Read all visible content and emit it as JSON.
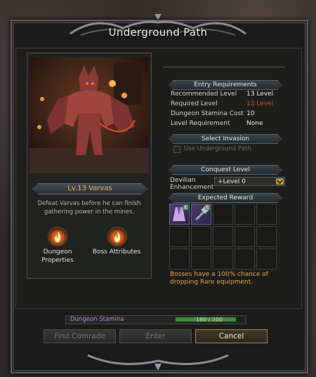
{
  "window": {
    "title": "Underground Path"
  },
  "boss": {
    "name": "Lv.13 Varvas",
    "description": "Defeat Varvas before he can finish gathering power in the mines.",
    "dungeon_properties_label": "Dungeon Properties",
    "boss_attributes_label": "Boss Attributes"
  },
  "entry": {
    "header": "Entry Requirements",
    "rows": [
      {
        "label": "Recommended Level",
        "value": "13 Level"
      },
      {
        "label": "Required Level",
        "value": "13 Level"
      },
      {
        "label": "Dungeon Stamina Cost",
        "value": "10"
      },
      {
        "label": "Level Requirement",
        "value": "None"
      }
    ]
  },
  "invasion": {
    "header": "Select Invasion",
    "checkbox_label": "Use Underground Path"
  },
  "conquest": {
    "header": "Conquest Level",
    "devilian_label": "Devilian Enhancement",
    "selected": "+Level 0"
  },
  "reward": {
    "header": "Expected Reward",
    "items": [
      {
        "icon": "robe-icon",
        "badge": "E"
      },
      {
        "icon": "hammer-icon",
        "badge": "E"
      }
    ],
    "notice": "Bosses have a 100% chance of dropping Rare equipment."
  },
  "stamina": {
    "label": "Dungeon Stamina",
    "text": "180 / 200",
    "fraction": 0.9
  },
  "buttons": {
    "find_comrade": "Find Comrade",
    "enter": "Enter",
    "cancel": "Cancel"
  },
  "colors": {
    "accent_gold": "#e7b35a",
    "required_red": "#e3412e",
    "notice_orange": "#e4a23a",
    "stamina_purple": "#b28dd7"
  }
}
